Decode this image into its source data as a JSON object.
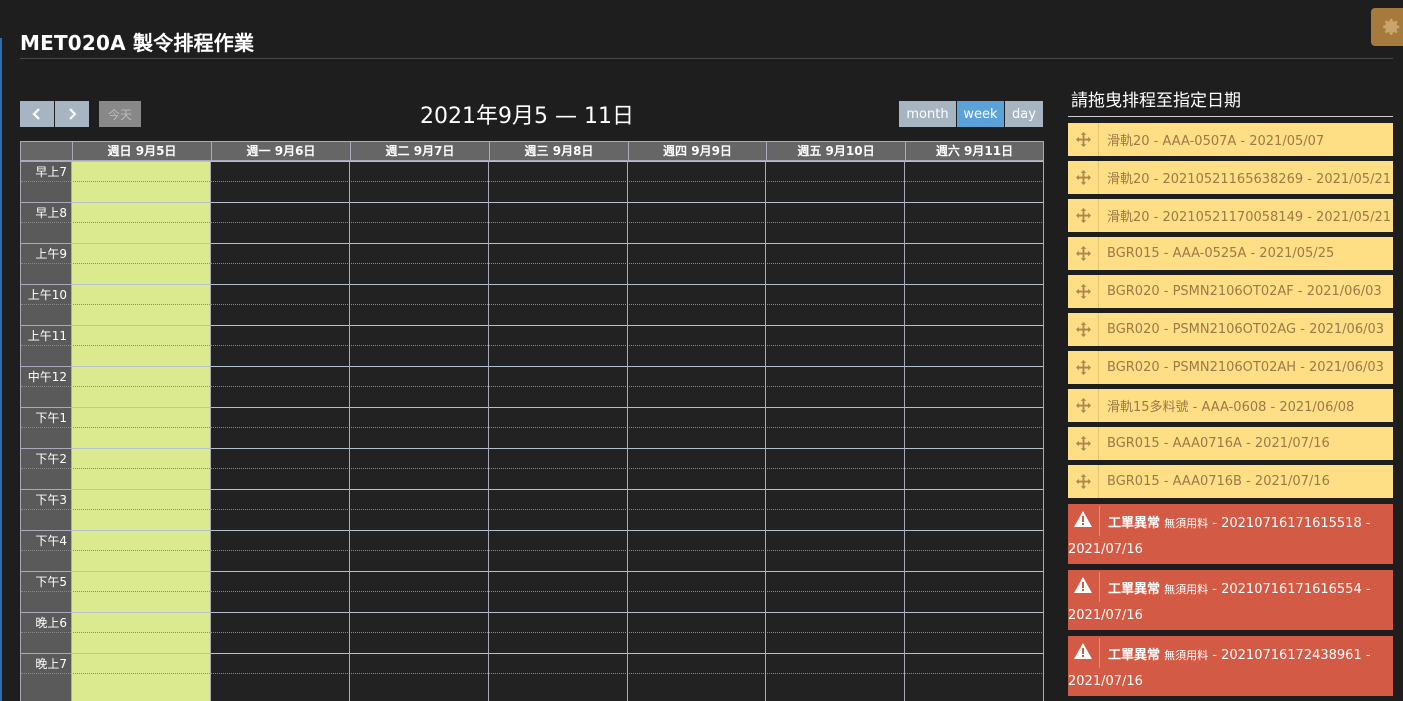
{
  "page": {
    "title": "MET020A 製令排程作業"
  },
  "toolbar": {
    "prev_label": "‹",
    "next_label": "›",
    "today_label": "今天",
    "calendar_title": "2021年9月5 — 11日",
    "views": [
      "month",
      "week",
      "day"
    ],
    "active_view": "week"
  },
  "calendar": {
    "day_headers": [
      "週日 9月5日",
      "週一 9月6日",
      "週二 9月7日",
      "週三 9月8日",
      "週四 9月9日",
      "週五 9月10日",
      "週六 9月11日"
    ],
    "hours": [
      "早上7",
      "早上8",
      "上午9",
      "上午10",
      "上午11",
      "中午12",
      "下午1",
      "下午2",
      "下午3",
      "下午4",
      "下午5",
      "晚上6",
      "晚上7"
    ],
    "today_color": "#dcea8f"
  },
  "panel": {
    "title": "請拖曳排程至指定日期",
    "items": [
      "滑軌20 - AAA-0507A - 2021/05/07",
      "滑軌20 - 20210521165638269 - 2021/05/21",
      "滑軌20 - 20210521170058149 - 2021/05/21",
      "BGR015 - AAA-0525A - 2021/05/25",
      "BGR020 - PSMN2106OT02AF - 2021/06/03",
      "BGR020 - PSMN2106OT02AG - 2021/06/03",
      "BGR020 - PSMN2106OT02AH - 2021/06/03",
      "滑軌15多料號 - AAA-0608 - 2021/06/08",
      "BGR015 - AAA0716A - 2021/07/16",
      "BGR015 - AAA0716B - 2021/07/16"
    ],
    "warnings": [
      {
        "type": "工單異常",
        "reason": "無須用料",
        "line1_tail": " - 20210716171615518 -",
        "line2": "2021/07/16"
      },
      {
        "type": "工單異常",
        "reason": "無須用料",
        "line1_tail": " - 20210716171616554 -",
        "line2": "2021/07/16"
      },
      {
        "type": "工單異常",
        "reason": "無須用料",
        "line1_tail": " - 20210716172438961 -",
        "line2": "2021/07/16"
      }
    ],
    "item_color": "#ffdf86",
    "warning_color": "#d35b45"
  }
}
